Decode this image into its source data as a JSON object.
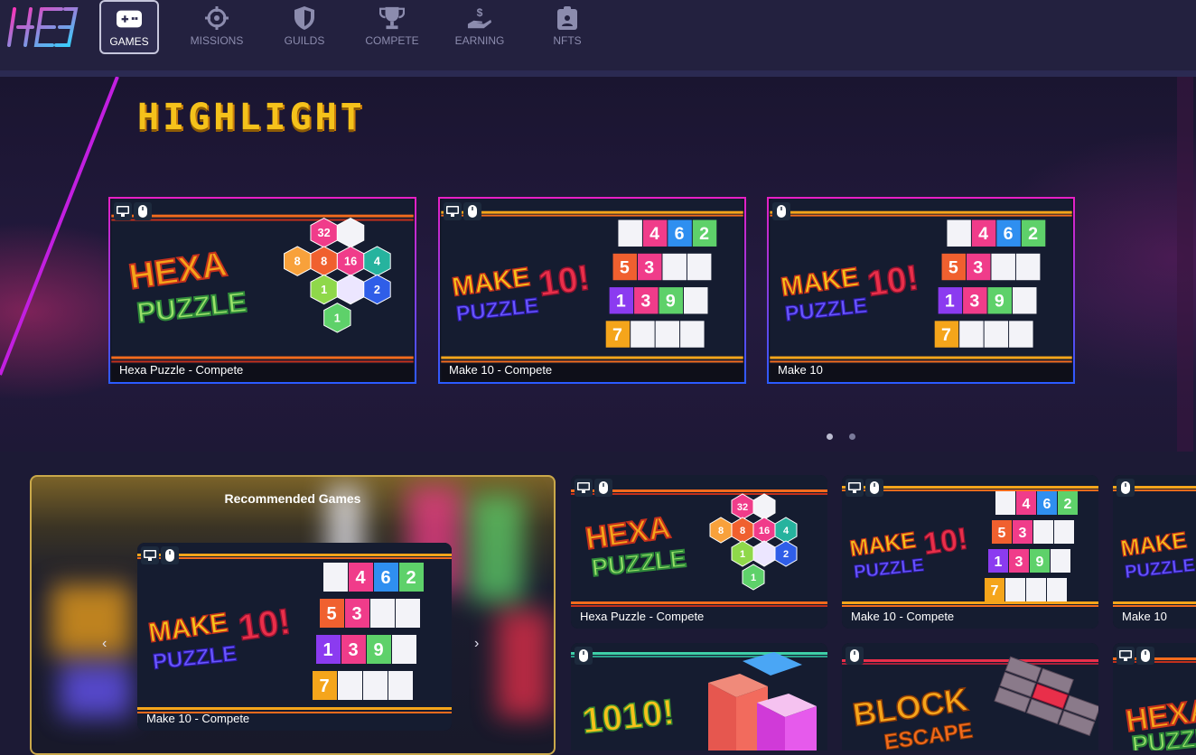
{
  "nav": {
    "items": [
      {
        "label": "GAMES",
        "icon": "gamepad-icon",
        "active": true
      },
      {
        "label": "MISSIONS",
        "icon": "crosshair-icon",
        "active": false
      },
      {
        "label": "GUILDS",
        "icon": "shield-icon",
        "active": false
      },
      {
        "label": "COMPETE",
        "icon": "trophy-icon",
        "active": false
      },
      {
        "label": "EARNING",
        "icon": "money-hand-icon",
        "active": false
      },
      {
        "label": "NFTS",
        "icon": "badge-icon",
        "active": false
      }
    ]
  },
  "highlight": {
    "title": "HIGHLIGHT",
    "cards": [
      {
        "label": "Hexa Puzzle - Compete",
        "platforms": [
          "desktop-icon",
          "mouse-icon"
        ]
      },
      {
        "label": "Make 10 - Compete",
        "platforms": [
          "desktop-icon",
          "mouse-icon"
        ]
      },
      {
        "label": "Make 10",
        "platforms": [
          "mouse-icon"
        ]
      }
    ]
  },
  "recommended": {
    "title": "Recommended Games",
    "card": {
      "label": "Make 10 - Compete"
    },
    "prev_arrow": "‹",
    "next_arrow": "›"
  },
  "grid": {
    "row1": [
      {
        "label": "Hexa Puzzle - Compete"
      },
      {
        "label": "Make 10 - Compete"
      },
      {
        "label": "Make 10"
      }
    ],
    "row2": [
      {
        "label": "1010!"
      },
      {
        "label": "Block Escape"
      },
      {
        "label": "Hexa Puzzle"
      }
    ]
  },
  "art_text": {
    "hexa_1": "HEXA",
    "hexa_2": "PUZZLE",
    "make": "MAKE",
    "puzzle": "PUZZLE",
    "ten": "10!",
    "grid_nums": [
      "4",
      "6",
      "2",
      "5",
      "3",
      "1",
      "3",
      "9",
      "7"
    ],
    "hex_nums": [
      "32",
      "8",
      "8",
      "16",
      "4",
      "1",
      "2",
      "1"
    ],
    "tenten": "1010!",
    "block": "BLOCK",
    "escape": "ESCAPE"
  },
  "colors": {
    "accent_gold": "#f5c21b",
    "card_border_top": "#e81fc5",
    "card_border_bottom": "#2b5bff",
    "rec_border": "#c9a84a"
  }
}
